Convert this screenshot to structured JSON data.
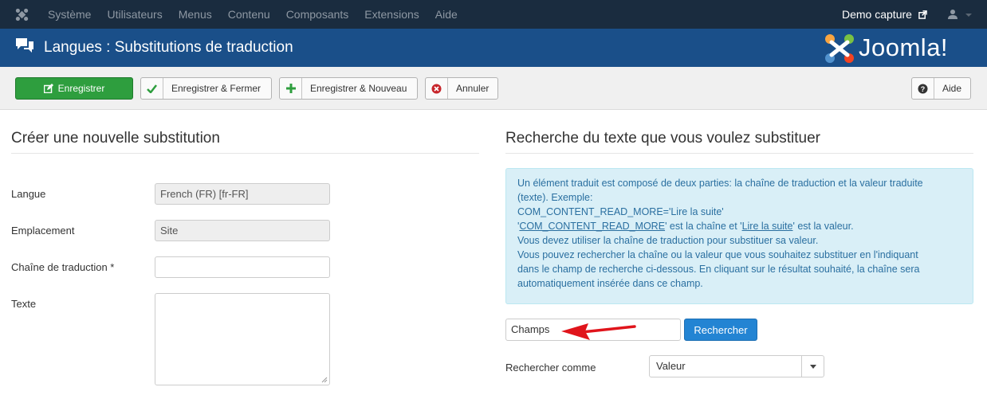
{
  "topnav": {
    "menu": [
      "Système",
      "Utilisateurs",
      "Menus",
      "Contenu",
      "Composants",
      "Extensions",
      "Aide"
    ],
    "site_link": "Demo capture"
  },
  "header": {
    "title": "Langues : Substitutions de traduction",
    "brand": "Joomla!"
  },
  "toolbar": {
    "save": "Enregistrer",
    "save_close": "Enregistrer & Fermer",
    "save_new": "Enregistrer & Nouveau",
    "cancel": "Annuler",
    "help": "Aide"
  },
  "form": {
    "heading": "Créer une nouvelle substitution",
    "language_label": "Langue",
    "language_value": "French (FR) [fr-FR]",
    "location_label": "Emplacement",
    "location_value": "Site",
    "constant_label": "Chaîne de traduction *",
    "constant_value": "",
    "text_label": "Texte",
    "text_value": ""
  },
  "search": {
    "heading": "Recherche du texte que vous voulez substituer",
    "info": {
      "line1": "Un élément traduit est composé de deux parties: la chaîne de traduction et la valeur traduite",
      "line2": "(texte). Exemple:",
      "line3": "COM_CONTENT_READ_MORE='Lire la suite'",
      "line4_const": "COM_CONTENT_READ_MORE",
      "line4_mid": "' est la chaîne et '",
      "line4_value": "Lire la suite",
      "line4_end": "' est la valeur.",
      "line5": "Vous devez utiliser la chaîne de traduction pour substituer sa valeur.",
      "line6": "Vous pouvez rechercher la chaîne ou la valeur que vous souhaitez substituer en l'indiquant",
      "line7": "dans le champ de recherche ci-dessous. En cliquant sur le résultat souhaité, la chaîne sera",
      "line8": "automatiquement insérée dans ce champ."
    },
    "input_value": "Champs",
    "button": "Rechercher",
    "search_as_label": "Rechercher comme",
    "search_as_value": "Valeur"
  },
  "colors": {
    "topnav": "#1a2c3f",
    "header": "#1a4f89",
    "save_button": "#2e9e3e",
    "search_button": "#2384d3",
    "arrow": "#e0141b"
  }
}
